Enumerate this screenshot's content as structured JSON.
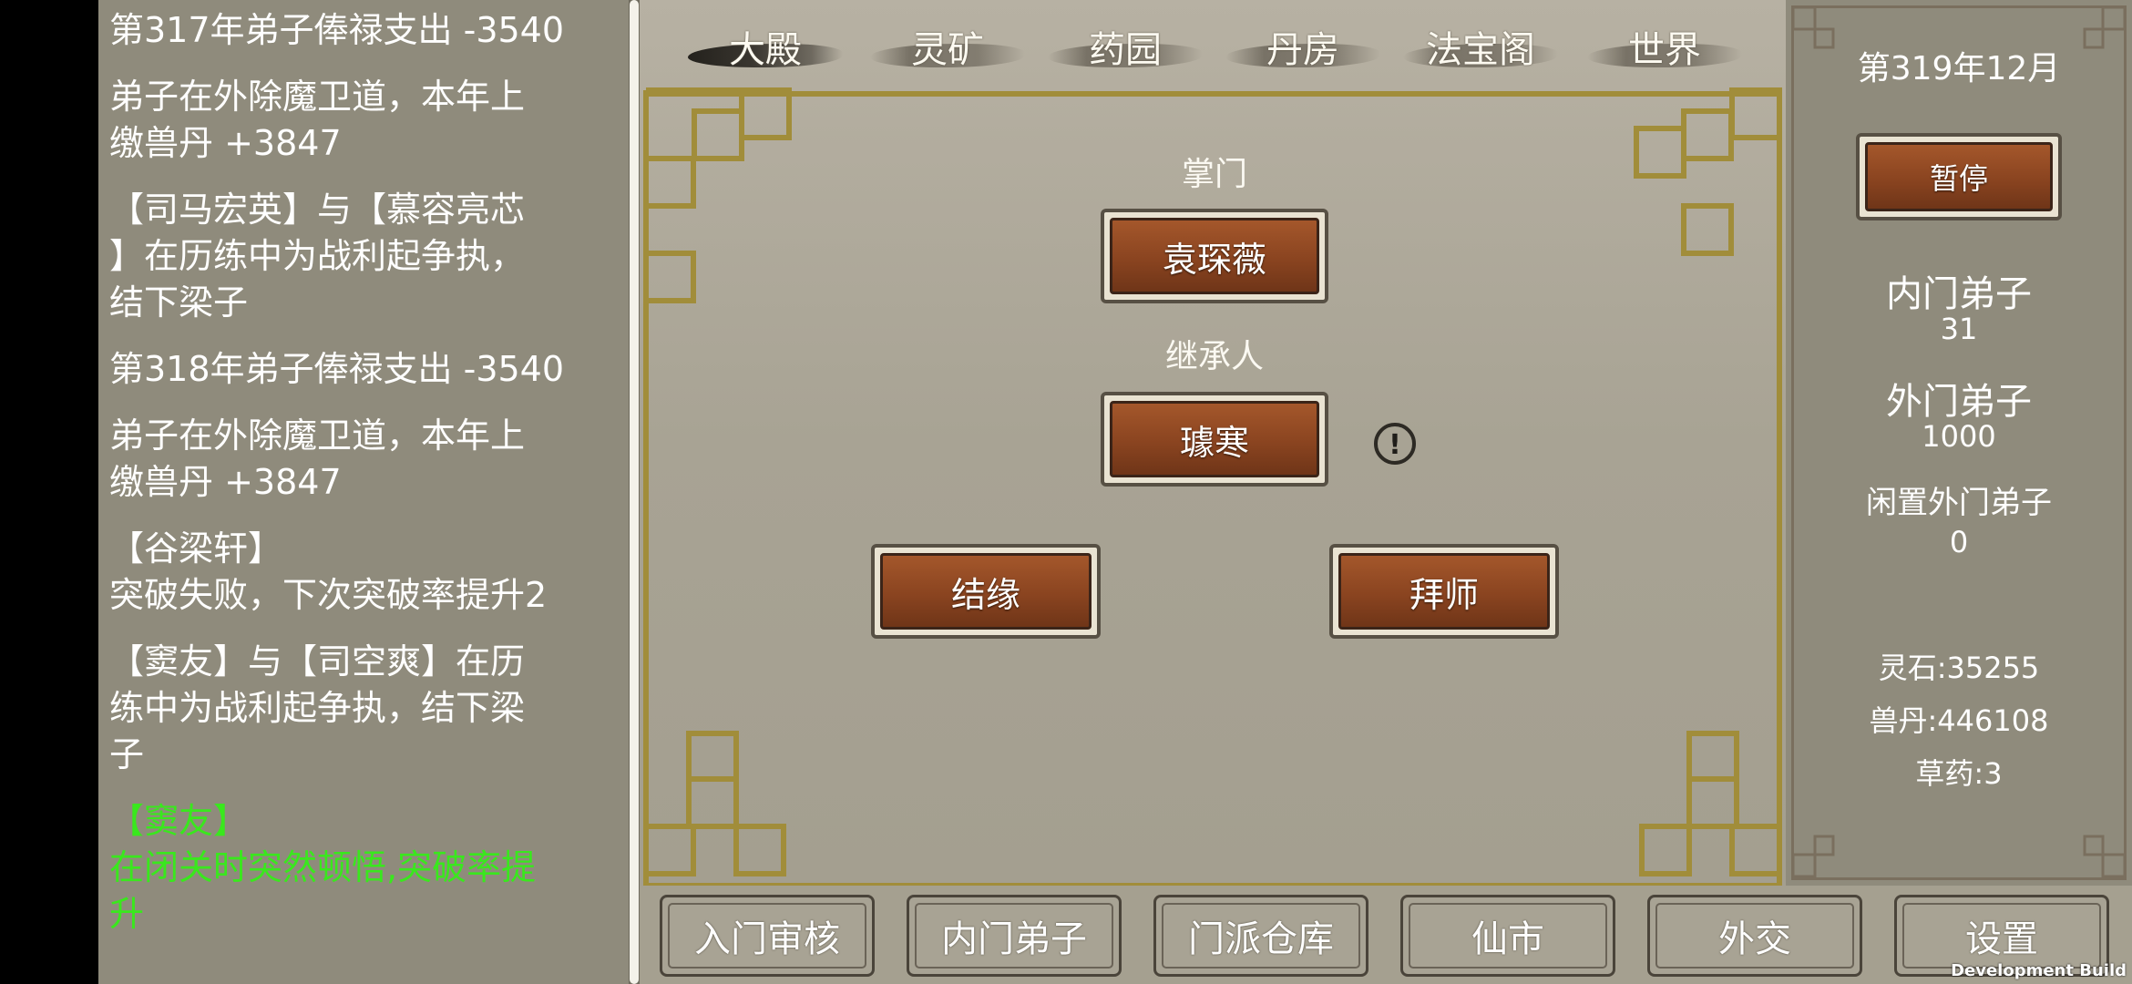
{
  "log": {
    "entries": [
      {
        "lines": [
          "第317年弟子俸禄支出 -3540"
        ],
        "highlight": false
      },
      {
        "lines": [
          "弟子在外除魔卫道，本年上",
          "缴兽丹 +3847"
        ],
        "highlight": false
      },
      {
        "lines": [
          "【司马宏英】与【慕容亮芯",
          "】在历练中为战利起争执，",
          "结下梁子"
        ],
        "highlight": false
      },
      {
        "lines": [
          "第318年弟子俸禄支出 -3540"
        ],
        "highlight": false
      },
      {
        "lines": [
          "弟子在外除魔卫道，本年上",
          "缴兽丹 +3847"
        ],
        "highlight": false
      },
      {
        "lines": [
          "【谷梁轩】",
          "突破失败，下次突破率提升2"
        ],
        "highlight": false
      },
      {
        "lines": [
          "【窦友】与【司空爽】在历",
          "练中为战利起争执，结下梁",
          "子"
        ],
        "highlight": false
      },
      {
        "lines": [
          "【窦友】",
          "在闭关时突然顿悟,突破率提",
          "升"
        ],
        "highlight": true
      }
    ]
  },
  "tabs": [
    {
      "label": "大殿",
      "active": true
    },
    {
      "label": "灵矿",
      "active": false
    },
    {
      "label": "药园",
      "active": false
    },
    {
      "label": "丹房",
      "active": false
    },
    {
      "label": "法宝阁",
      "active": false
    },
    {
      "label": "世界",
      "active": false
    }
  ],
  "hall": {
    "leader_label": "掌门",
    "leader_name": "袁琛薇",
    "heir_label": "继承人",
    "heir_name": "璩寒",
    "alert_symbol": "!",
    "marriage_button": "结缘",
    "apprentice_button": "拜师"
  },
  "status": {
    "date": "第319年12月",
    "pause_button": "暂停",
    "inner_disciples_label": "内门弟子",
    "inner_disciples_value": "31",
    "outer_disciples_label": "外门弟子",
    "outer_disciples_value": "1000",
    "idle_outer_label": "闲置外门弟子",
    "idle_outer_value": "0",
    "spirit_stone": "灵石:35255",
    "beast_pill": "兽丹:446108",
    "herbs": "草药:3"
  },
  "bottom_nav": [
    "入门审核",
    "内门弟子",
    "门派仓库",
    "仙市",
    "外交",
    "设置"
  ],
  "footer": {
    "dev_build": "Development Build"
  },
  "colors": {
    "accent_frame": "#a18d3a",
    "button_bronze": "#8a4420",
    "log_highlight": "#39e81d"
  }
}
